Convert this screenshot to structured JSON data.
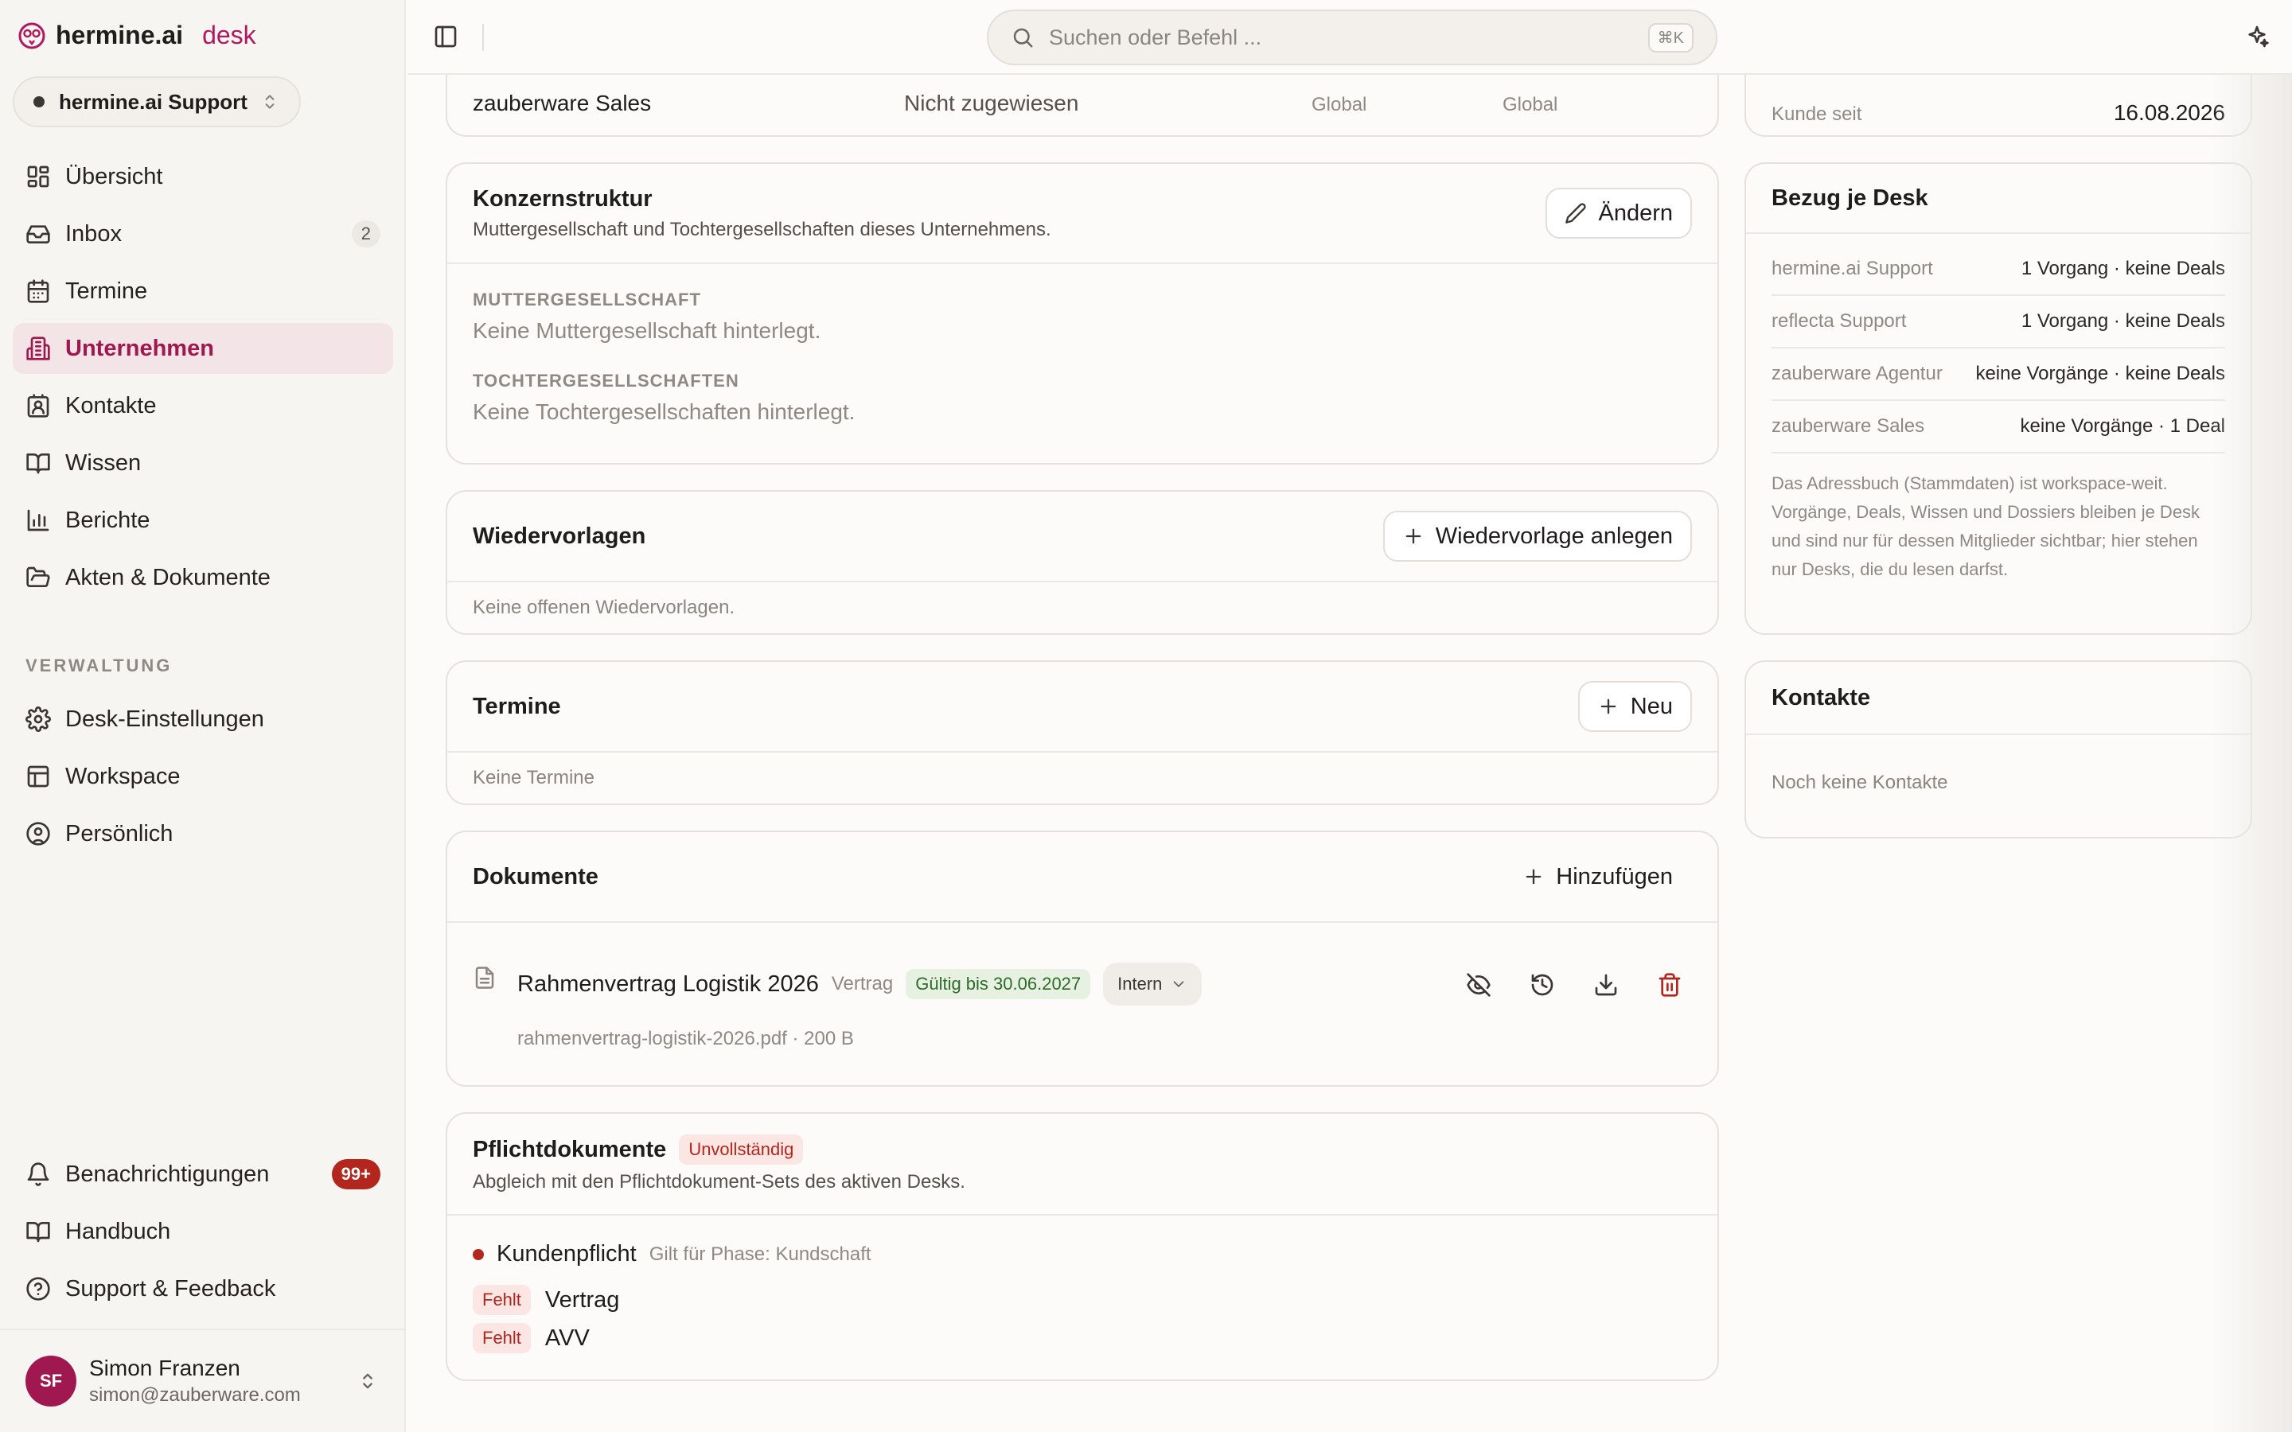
{
  "brand": {
    "name": "hermine.ai",
    "accent": "desk"
  },
  "desk_switch": {
    "label": "hermine.ai Support"
  },
  "nav": {
    "overview": "Übersicht",
    "inbox": "Inbox",
    "inbox_count": "2",
    "appointments": "Termine",
    "companies": "Unternehmen",
    "contacts": "Kontakte",
    "knowledge": "Wissen",
    "reports": "Berichte",
    "files": "Akten & Dokumente"
  },
  "admin": {
    "section": "VERWALTUNG",
    "desk_settings": "Desk-Einstellungen",
    "workspace": "Workspace",
    "personal": "Persönlich"
  },
  "footer_nav": {
    "notifications": "Benachrichtigungen",
    "notifications_badge": "99+",
    "manual": "Handbuch",
    "support": "Support & Feedback"
  },
  "user": {
    "initials": "SF",
    "name": "Simon Franzen",
    "email": "simon@zauberware.com"
  },
  "search": {
    "placeholder": "Suchen oder Befehl ...",
    "shortcut": "⌘K"
  },
  "assignment_row": {
    "desk": "zauberware Sales",
    "status": "Nicht zugewiesen",
    "scope1": "Global",
    "scope2": "Global"
  },
  "group_structure": {
    "title": "Konzernstruktur",
    "subtitle": "Muttergesellschaft und Tochtergesellschaften dieses Unternehmens.",
    "edit": "Ändern",
    "parent_label": "MUTTERGESELLSCHAFT",
    "parent_empty": "Keine Muttergesellschaft hinterlegt.",
    "child_label": "TOCHTERGESELLSCHAFTEN",
    "child_empty": "Keine Tochtergesellschaften hinterlegt."
  },
  "followups": {
    "title": "Wiedervorlagen",
    "button": "Wiedervorlage anlegen",
    "empty": "Keine offenen Wiedervorlagen."
  },
  "appointments": {
    "title": "Termine",
    "button": "Neu",
    "empty": "Keine Termine"
  },
  "documents": {
    "title": "Dokumente",
    "button": "Hinzufügen",
    "items": [
      {
        "name": "Rahmenvertrag Logistik 2026",
        "type": "Vertrag",
        "validity": "Gültig bis 30.06.2027",
        "visibility": "Intern",
        "file": "rahmenvertrag-logistik-2026.pdf · 200 B"
      }
    ]
  },
  "required_docs": {
    "title": "Pflichtdokumente",
    "status": "Unvollständig",
    "subtitle": "Abgleich mit den Pflichtdokument-Sets des aktiven Desks.",
    "set_name": "Kundenpflicht",
    "set_phase": "Gilt für Phase: Kundschaft",
    "items": [
      {
        "status": "Fehlt",
        "name": "Vertrag"
      },
      {
        "status": "Fehlt",
        "name": "AVV"
      }
    ]
  },
  "customer_since": {
    "label": "Kunde seit",
    "value": "16.08.2026"
  },
  "per_desk": {
    "title": "Bezug je Desk",
    "rows": [
      {
        "desk": "hermine.ai Support",
        "value": "1 Vorgang · keine Deals"
      },
      {
        "desk": "reflecta Support",
        "value": "1 Vorgang · keine Deals"
      },
      {
        "desk": "zauberware Agentur",
        "value": "keine Vorgänge · keine Deals"
      },
      {
        "desk": "zauberware Sales",
        "value": "keine Vorgänge · 1 Deal"
      }
    ],
    "note": "Das Adressbuch (Stammdaten) ist workspace-weit. Vorgänge, Deals, Wissen und Dossiers bleiben je Desk und sind nur für dessen Mitglieder sichtbar; hier stehen nur Desks, die du lesen darfst."
  },
  "contacts_card": {
    "title": "Kontakte",
    "empty": "Noch keine Kontakte"
  },
  "colors": {
    "accent": "#b0195e",
    "danger": "#b3261e",
    "success": "#2f6b2b"
  }
}
